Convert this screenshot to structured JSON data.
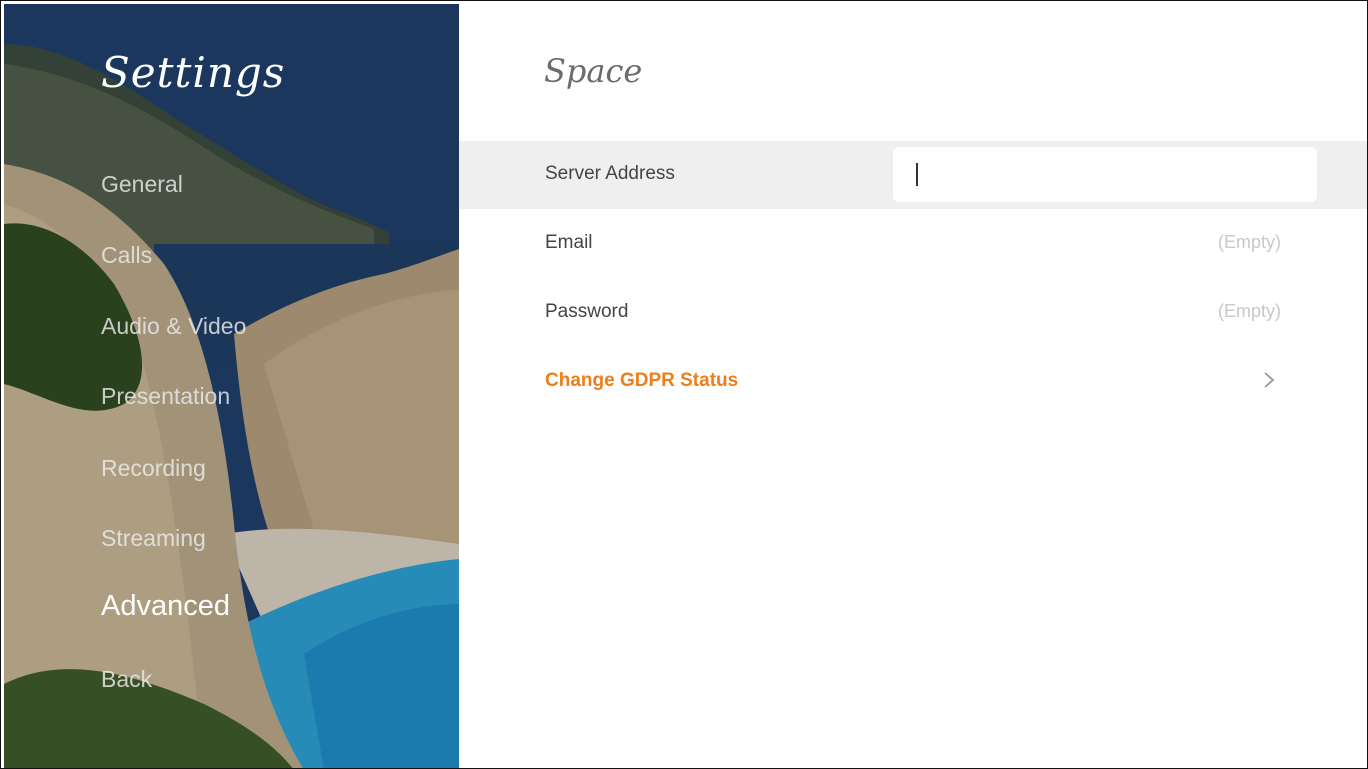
{
  "sidebar": {
    "title": "Settings",
    "items": [
      {
        "label": "General",
        "active": false
      },
      {
        "label": "Calls",
        "active": false
      },
      {
        "label": "Audio & Video",
        "active": false
      },
      {
        "label": "Presentation",
        "active": false
      },
      {
        "label": "Recording",
        "active": false
      },
      {
        "label": "Streaming",
        "active": false
      },
      {
        "label": "Advanced",
        "active": true
      },
      {
        "label": "Back",
        "active": false
      }
    ]
  },
  "main": {
    "title": "Space",
    "server_address": {
      "label": "Server Address",
      "value": ""
    },
    "email": {
      "label": "Email",
      "value": "(Empty)"
    },
    "password": {
      "label": "Password",
      "value": "(Empty)"
    },
    "gdpr": {
      "label": "Change GDPR Status",
      "icon": "chevron-right-icon"
    }
  },
  "colors": {
    "accent": "#ef7d1a",
    "highlight_row": "#efefef"
  }
}
